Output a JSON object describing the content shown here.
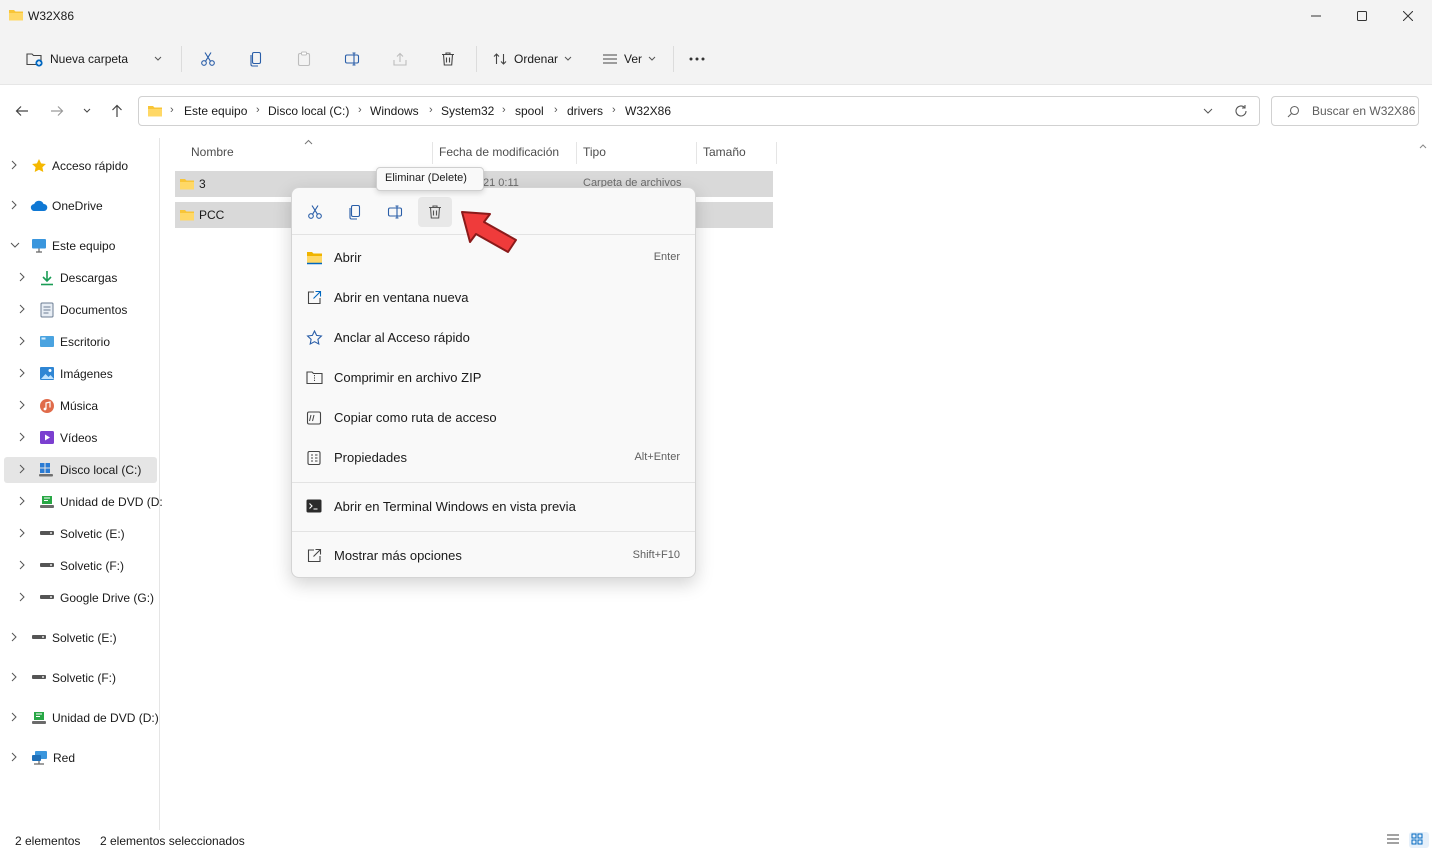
{
  "window": {
    "title": "W32X86"
  },
  "toolbar": {
    "new_folder": "Nueva carpeta",
    "sort": "Ordenar",
    "view": "Ver"
  },
  "address": {
    "breadcrumbs": [
      "Este equipo",
      "Disco local (C:)",
      "Windows",
      "System32",
      "spool",
      "drivers",
      "W32X86"
    ],
    "search_placeholder": "Buscar en W32X86"
  },
  "nav": {
    "items": [
      {
        "label": "Acceso rápido",
        "icon": "star-icon"
      },
      {
        "label": "OneDrive",
        "icon": "cloud-icon"
      },
      {
        "label": "Este equipo",
        "icon": "computer-icon"
      },
      {
        "label": "Descargas",
        "icon": "download-icon"
      },
      {
        "label": "Documentos",
        "icon": "document-icon"
      },
      {
        "label": "Escritorio",
        "icon": "desktop-icon"
      },
      {
        "label": "Imágenes",
        "icon": "image-icon"
      },
      {
        "label": "Música",
        "icon": "music-icon"
      },
      {
        "label": "Vídeos",
        "icon": "video-icon"
      },
      {
        "label": "Disco local (C:)",
        "icon": "drive-c-icon"
      },
      {
        "label": "Unidad de DVD (D:",
        "icon": "dvd-icon"
      },
      {
        "label": "Solvetic (E:)",
        "icon": "drive-icon"
      },
      {
        "label": "Solvetic (F:)",
        "icon": "drive-icon"
      },
      {
        "label": "Google Drive (G:)",
        "icon": "drive-icon"
      },
      {
        "label": "Solvetic (E:)",
        "icon": "drive-icon"
      },
      {
        "label": "Solvetic (F:)",
        "icon": "drive-icon"
      },
      {
        "label": "Unidad de DVD (D:)",
        "icon": "dvd-icon"
      },
      {
        "label": "Red",
        "icon": "network-icon"
      }
    ]
  },
  "columns": {
    "name": "Nombre",
    "date": "Fecha de modificación",
    "type": "Tipo",
    "size": "Tamaño"
  },
  "files": [
    {
      "name": "3",
      "date": "21 0:11",
      "type": "Carpeta de archivos"
    },
    {
      "name": "PCC",
      "date": "",
      "type": ""
    }
  ],
  "tooltip": "Eliminar (Delete)",
  "context_menu": {
    "items": [
      {
        "label": "Abrir",
        "shortcut": "Enter"
      },
      {
        "label": "Abrir en ventana nueva",
        "shortcut": ""
      },
      {
        "label": "Anclar al Acceso rápido",
        "shortcut": ""
      },
      {
        "label": "Comprimir en archivo ZIP",
        "shortcut": ""
      },
      {
        "label": "Copiar como ruta de acceso",
        "shortcut": ""
      },
      {
        "label": "Propiedades",
        "shortcut": "Alt+Enter"
      },
      {
        "label": "Abrir en Terminal Windows en vista previa",
        "shortcut": ""
      },
      {
        "label": "Mostrar más opciones",
        "shortcut": "Shift+F10"
      }
    ]
  },
  "status": {
    "count": "2 elementos",
    "selected": "2 elementos seleccionados"
  },
  "colors": {
    "accent": "#0067c0",
    "folder": "#f8c537",
    "arrow": "#ef3b3b",
    "selection": "#d9d9d9"
  }
}
